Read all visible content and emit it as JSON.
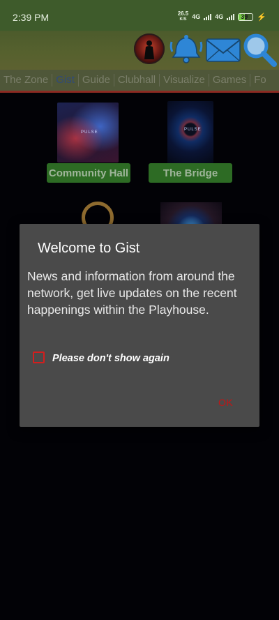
{
  "status_bar": {
    "time": "2:39 PM",
    "speed_value": "26.5",
    "speed_unit": "K/S",
    "net1": "4G",
    "net2": "4G",
    "battery": "39"
  },
  "header": {
    "icons": [
      "avatar",
      "bell-icon",
      "mail-icon",
      "search-icon"
    ]
  },
  "tabs": [
    {
      "label": "The Zone",
      "active": false
    },
    {
      "label": "Gist",
      "active": true
    },
    {
      "label": "Guide",
      "active": false
    },
    {
      "label": "Clubhall",
      "active": false
    },
    {
      "label": "Visualize",
      "active": false
    },
    {
      "label": "Games",
      "active": false
    },
    {
      "label": "Fo",
      "active": false
    }
  ],
  "cards": [
    {
      "label": "Community Hall",
      "image_text": "PULSE"
    },
    {
      "label": "The Bridge",
      "image_text": "PULSE"
    }
  ],
  "dialog": {
    "title": "Welcome to Gist",
    "message": "News and information from around the network, get live updates on the recent happenings within the Playhouse.",
    "checkbox_label": "Please don't show again",
    "checkbox_checked": false,
    "ok_label": "OK"
  },
  "colors": {
    "status_bar": "#3e5b2b",
    "tab_active": "#2f4a7a",
    "card_button": "#2d6b24",
    "checkbox": "#d31e1e",
    "ok": "#c11515",
    "dialog_bg": "#4a4a4a"
  }
}
